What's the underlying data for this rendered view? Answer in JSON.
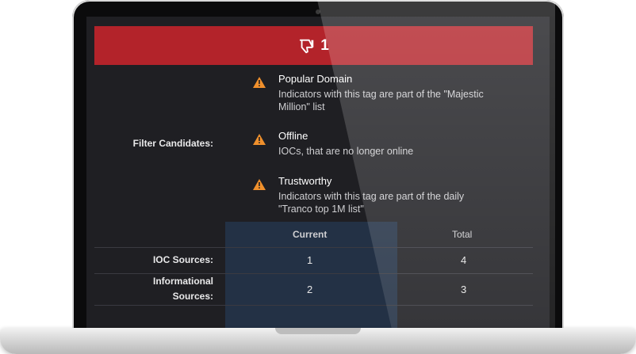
{
  "banner": {
    "count": "1",
    "icon": "thumbs-down-icon",
    "color": "#b3232a"
  },
  "filter_candidates": {
    "label": "Filter Candidates:",
    "items": [
      {
        "title": "Popular Domain",
        "desc_line1": "Indicators with this tag are part of the \"Majestic",
        "desc_line2": "Million\" list",
        "icon": "warning-icon"
      },
      {
        "title": "Offline",
        "desc_line1": "IOCs, that are no longer online",
        "desc_line2": "",
        "icon": "warning-icon"
      },
      {
        "title": "Trustworthy",
        "desc_line1": "Indicators with this tag are part of the daily",
        "desc_line2": "\"Tranco top 1M list\"",
        "icon": "warning-icon"
      }
    ]
  },
  "table": {
    "headers": [
      "Current",
      "Total"
    ],
    "rows": [
      {
        "label_line1": "IOC Sources:",
        "label_line2": "",
        "current": "1",
        "total": "4"
      },
      {
        "label_line1": "Informational",
        "label_line2": "Sources:",
        "current": "2",
        "total": "3"
      }
    ]
  },
  "colors": {
    "accent_warning": "#f0902c",
    "background": "#1f1f23",
    "highlight_column": "#233145"
  }
}
